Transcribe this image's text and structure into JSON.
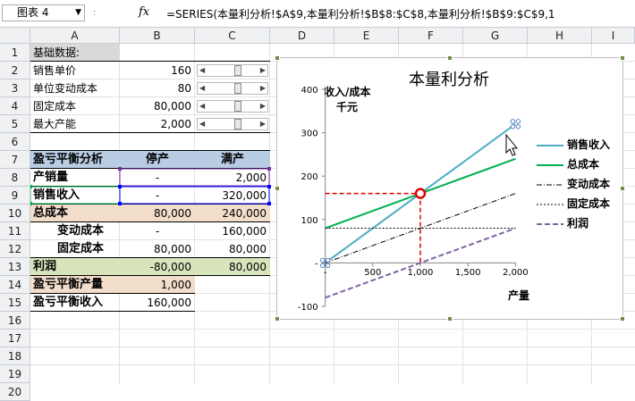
{
  "formula_bar": {
    "name_box": "图表 4",
    "name_box_chevron": "chevron-down",
    "separator": ":",
    "fx_label": "fx",
    "formula": "=SERIES(本量利分析!$A$9,本量利分析!$B$8:$C$8,本量利分析!$B$9:$C$9,1"
  },
  "columns": [
    "A",
    "B",
    "C",
    "D",
    "E",
    "F",
    "G",
    "H",
    "I"
  ],
  "rows": [
    "1",
    "2",
    "3",
    "4",
    "5",
    "6",
    "7",
    "8",
    "9",
    "10",
    "11",
    "12",
    "13",
    "14",
    "15",
    "16",
    "17",
    "18",
    "19",
    "20"
  ],
  "cells": {
    "A1": "基础数据:",
    "A2": "销售单价",
    "B2": "160",
    "A3": "单位变动成本",
    "B3": "80",
    "A4": "固定成本",
    "B4": "80,000",
    "A5": "最大产能",
    "B5": "2,000",
    "A7": "盈亏平衡分析",
    "B7": "停产",
    "C7": "满产",
    "A8": "产销量",
    "B8": "-",
    "C8": "2,000",
    "A9": "销售收入",
    "B9": "-",
    "C9": "320,000",
    "A10": "总成本",
    "B10": "80,000",
    "C10": "240,000",
    "A11": "变动成本",
    "B11": "-",
    "C11": "160,000",
    "A12": "固定成本",
    "B12": "80,000",
    "C12": "80,000",
    "A13": "利润",
    "B13": "-80,000",
    "C13": "80,000",
    "A15": "盈亏平衡产量",
    "B15": "1,000",
    "A16": "盈亏平衡收入",
    "B16": "160,000"
  },
  "sliders": [
    {
      "label": "销售单价",
      "level": 0.55
    },
    {
      "label": "单位变动成本",
      "level": 0.55
    },
    {
      "label": "固定成本",
      "level": 0.55
    },
    {
      "label": "最大产能",
      "level": 0.55
    }
  ],
  "colors": {
    "header_blue": "#b8cce4",
    "peach": "#f2dcca",
    "green_fill": "#d8e4bc",
    "sales": "#4bacc6",
    "total": "#00b050",
    "profit": "#8064a2",
    "break_even": "#e00000"
  },
  "chart_data": {
    "type": "line",
    "title": "本量利分析",
    "ylabel_line1": "收入/成本",
    "ylabel_line2": "千元",
    "xlabel": "产量",
    "xlim": [
      -100,
      2100
    ],
    "ylim": [
      -100,
      400
    ],
    "x_ticks": [
      "-",
      "500",
      "1,000",
      "1,500",
      "2,000"
    ],
    "y_ticks": [
      "-100",
      "-",
      "100",
      "200",
      "300",
      "400"
    ],
    "x_tick_values": [
      0,
      500,
      1000,
      1500,
      2000
    ],
    "y_tick_values": [
      -100,
      0,
      100,
      200,
      300,
      400
    ],
    "series": [
      {
        "name": "销售收入",
        "x": [
          0,
          2000
        ],
        "y": [
          0,
          320
        ]
      },
      {
        "name": "总成本",
        "x": [
          0,
          2000
        ],
        "y": [
          80,
          240
        ]
      },
      {
        "name": "变动成本",
        "x": [
          0,
          2000
        ],
        "y": [
          0,
          160
        ]
      },
      {
        "name": "固定成本",
        "x": [
          0,
          2000
        ],
        "y": [
          80,
          80
        ]
      },
      {
        "name": "利润",
        "x": [
          0,
          2000
        ],
        "y": [
          -80,
          80
        ]
      }
    ],
    "break_even": {
      "x": 1000,
      "y": 160
    },
    "legend_position": "right"
  }
}
